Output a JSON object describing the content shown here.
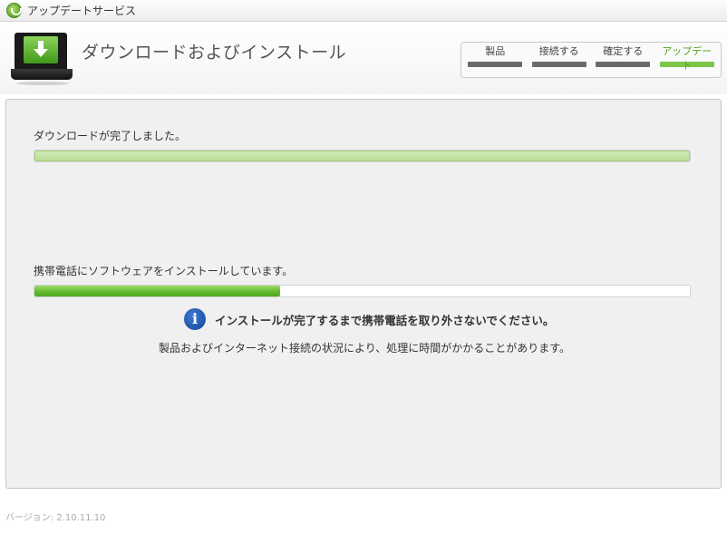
{
  "window": {
    "title": "アップデートサービス"
  },
  "header": {
    "title": "ダウンロードおよびインストール",
    "steps": [
      {
        "label": "製品",
        "active": false
      },
      {
        "label": "接続する",
        "active": false
      },
      {
        "label": "確定する",
        "active": false
      },
      {
        "label": "アップデート",
        "active": true
      }
    ]
  },
  "download": {
    "status": "ダウンロードが完了しました。",
    "progress": 1.0
  },
  "install": {
    "status": "携帯電話にソフトウェアをインストールしています。",
    "progress": 0.375
  },
  "warning": {
    "icon": "info-icon",
    "text": "インストールが完了するまで携帯電話を取り外さないでください。"
  },
  "note": "製品およびインターネット接続の状況により、処理に時間がかかることがあります。",
  "footer": {
    "version": "バージョン: 2.10.11.10"
  },
  "colors": {
    "accent_green": "#7dc64a",
    "step_inactive": "#6a6a6a",
    "info_blue": "#12459c"
  }
}
